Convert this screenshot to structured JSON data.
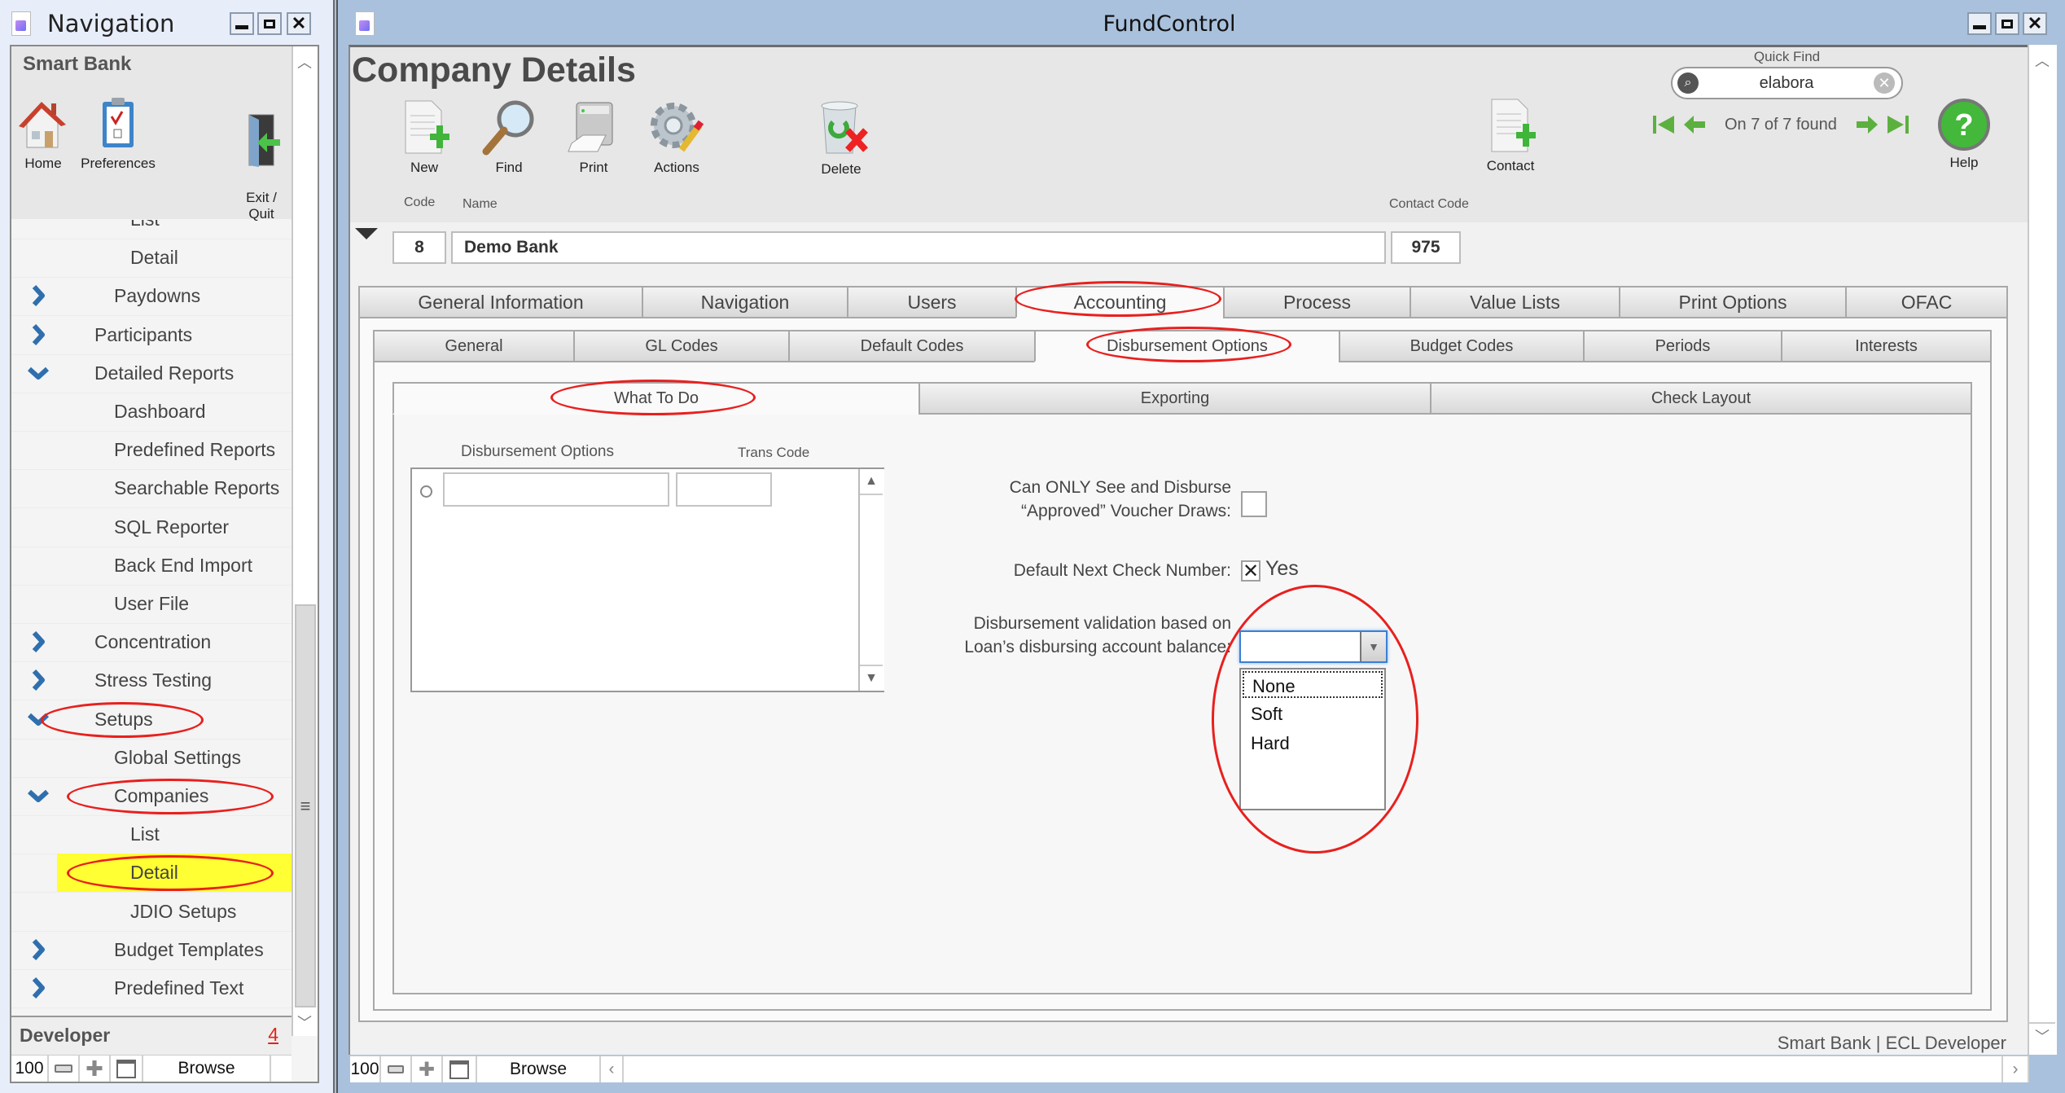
{
  "nav_window": {
    "title": "Navigation",
    "bank_name": "Smart Bank",
    "tools": [
      {
        "label": "Home",
        "icon": "home-icon"
      },
      {
        "label": "Preferences",
        "icon": "preferences-icon"
      },
      {
        "label": "Exit /\nQuit",
        "icon": "exit-icon"
      }
    ],
    "items": [
      {
        "label": "List",
        "level": 2,
        "arrow": "none"
      },
      {
        "label": "Detail",
        "level": 2,
        "arrow": "none"
      },
      {
        "label": "Paydowns",
        "level": 1.5,
        "arrow": "right"
      },
      {
        "label": "Participants",
        "level": 1,
        "arrow": "right"
      },
      {
        "label": "Detailed Reports",
        "level": 1,
        "arrow": "down"
      },
      {
        "label": "Dashboard",
        "level": 1.5,
        "arrow": "none"
      },
      {
        "label": "Predefined Reports",
        "level": 1.5,
        "arrow": "none"
      },
      {
        "label": "Searchable Reports",
        "level": 1.5,
        "arrow": "none"
      },
      {
        "label": "SQL Reporter",
        "level": 1.5,
        "arrow": "none"
      },
      {
        "label": "Back End Import",
        "level": 1.5,
        "arrow": "none"
      },
      {
        "label": "User File",
        "level": 1.5,
        "arrow": "none"
      },
      {
        "label": "Concentration",
        "level": 1,
        "arrow": "right"
      },
      {
        "label": "Stress Testing",
        "level": 1,
        "arrow": "right"
      },
      {
        "label": "Setups",
        "level": 1,
        "arrow": "down"
      },
      {
        "label": "Global Settings",
        "level": 1.5,
        "arrow": "none"
      },
      {
        "label": "Companies",
        "level": 1.5,
        "arrow": "down"
      },
      {
        "label": "List",
        "level": 2,
        "arrow": "none"
      },
      {
        "label": "Detail",
        "level": 2,
        "arrow": "none",
        "selected": true
      },
      {
        "label": "JDIO Setups",
        "level": 2,
        "arrow": "none"
      },
      {
        "label": "Budget Templates",
        "level": 1.5,
        "arrow": "right"
      },
      {
        "label": "Predefined Text",
        "level": 1.5,
        "arrow": "right"
      }
    ],
    "footer_label": "Developer",
    "footer_count": "4",
    "status": {
      "zoom": "100",
      "mode": "Browse"
    }
  },
  "main_window": {
    "title": "FundControl",
    "page_title": "Company Details",
    "toolbar": [
      {
        "label": "New",
        "icon": "new-record-icon"
      },
      {
        "label": "Find",
        "icon": "find-icon"
      },
      {
        "label": "Print",
        "icon": "print-icon"
      },
      {
        "label": "Actions",
        "icon": "actions-icon"
      },
      {
        "label": "Delete",
        "icon": "delete-icon"
      },
      {
        "label": "Contact",
        "icon": "new-contact-icon"
      },
      {
        "label": "Help",
        "icon": "help-icon"
      }
    ],
    "quick_find": {
      "label": "Quick Find",
      "value": "elabora"
    },
    "record_nav": {
      "text": "On 7 of 7 found"
    },
    "record": {
      "code_label": "Code",
      "name_label": "Name",
      "contact_code_label": "Contact Code",
      "code": "8",
      "name": "Demo Bank",
      "contact_code": "975"
    },
    "tabs_primary": [
      "General Information",
      "Navigation",
      "Users",
      "Accounting",
      "Process",
      "Value Lists",
      "Print Options",
      "OFAC"
    ],
    "tabs_primary_active": "Accounting",
    "tabs_secondary": [
      "General",
      "GL Codes",
      "Default Codes",
      "Disbursement Options",
      "Budget Codes",
      "Periods",
      "Interests"
    ],
    "tabs_secondary_active": "Disbursement Options",
    "tabs_tertiary": [
      "What To Do",
      "Exporting",
      "Check Layout"
    ],
    "tabs_tertiary_active": "What To Do",
    "portal": {
      "col_options": "Disbursement Options",
      "col_trans": "Trans Code",
      "rows": [
        {
          "option": "",
          "trans_code": ""
        }
      ]
    },
    "settings": {
      "approved_label_1": "Can ONLY See and Disburse",
      "approved_label_2": "“Approved” Voucher Draws:",
      "approved_checked": false,
      "check_number_label": "Default Next Check Number:",
      "check_number_checked": true,
      "check_number_value": "Yes",
      "validation_label_1": "Disbursement validation based on",
      "validation_label_2": "Loan’s disbursing account balance:",
      "validation_value": "",
      "validation_options": [
        "None",
        "Soft",
        "Hard"
      ]
    },
    "footer_user": "Smart Bank | ECL Developer",
    "status": {
      "zoom": "100",
      "mode": "Browse"
    }
  },
  "colors": {
    "annotation": "#e8201e",
    "highlight": "#ffff33",
    "titlebar": "#a9c1dc",
    "link_count": "#e2231a"
  }
}
